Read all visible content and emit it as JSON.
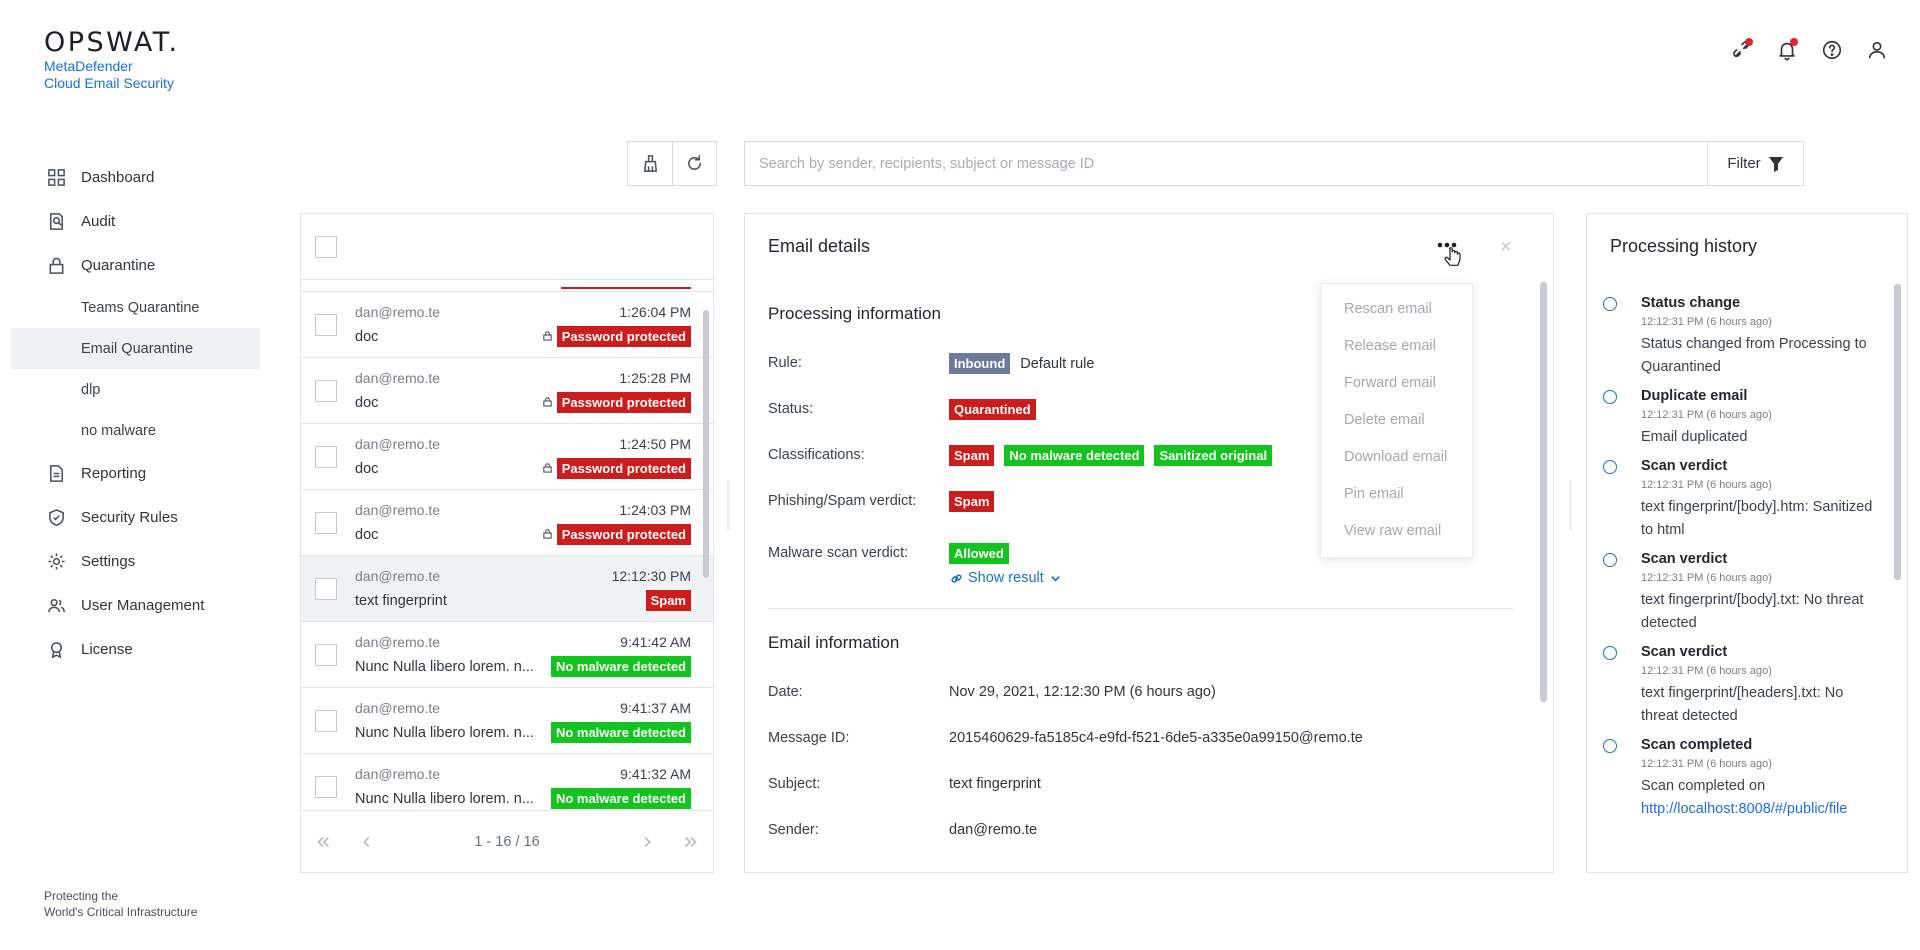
{
  "brand": {
    "wordmark": "OPSWAT.",
    "product_line1": "MetaDefender",
    "product_line2": "Cloud Email Security"
  },
  "header": {
    "icons": [
      "integration-icon",
      "bell-icon",
      "help-icon",
      "user-icon"
    ],
    "notification_color": "#e0262e"
  },
  "nav": {
    "items": [
      {
        "label": "Dashboard",
        "icon": "dashboard-icon"
      },
      {
        "label": "Audit",
        "icon": "audit-icon"
      },
      {
        "label": "Quarantine",
        "icon": "lock-icon"
      },
      {
        "label": "Reporting",
        "icon": "report-icon"
      },
      {
        "label": "Security Rules",
        "icon": "shield-check-icon"
      },
      {
        "label": "Settings",
        "icon": "gear-icon"
      },
      {
        "label": "User Management",
        "icon": "users-icon"
      },
      {
        "label": "License",
        "icon": "license-icon"
      }
    ],
    "quarantine_sub": [
      "Teams Quarantine",
      "Email Quarantine",
      "dlp",
      "no malware"
    ],
    "active_sub": "Email Quarantine"
  },
  "footer": {
    "line1": "Protecting the",
    "line2": "World's Critical Infrastructure"
  },
  "toolbar": {
    "search_placeholder": "Search by sender, recipients, subject or message ID",
    "search_value": "",
    "filter_label": "Filter"
  },
  "email_list": {
    "rows": [
      {
        "sender": "dan@remo.te",
        "time": "1:26:04 PM",
        "subject": "doc",
        "badge": "Password protected",
        "badge_color": "red",
        "locked": true,
        "selected": false
      },
      {
        "sender": "dan@remo.te",
        "time": "1:25:28 PM",
        "subject": "doc",
        "badge": "Password protected",
        "badge_color": "red",
        "locked": true,
        "selected": false
      },
      {
        "sender": "dan@remo.te",
        "time": "1:24:50 PM",
        "subject": "doc",
        "badge": "Password protected",
        "badge_color": "red",
        "locked": true,
        "selected": false
      },
      {
        "sender": "dan@remo.te",
        "time": "1:24:03 PM",
        "subject": "doc",
        "badge": "Password protected",
        "badge_color": "red",
        "locked": true,
        "selected": false
      },
      {
        "sender": "dan@remo.te",
        "time": "12:12:30 PM",
        "subject": "text fingerprint",
        "badge": "Spam",
        "badge_color": "red",
        "locked": false,
        "selected": true
      },
      {
        "sender": "dan@remo.te",
        "time": "9:41:42 AM",
        "subject": "Nunc Nulla libero lorem. n...",
        "badge": "No malware detected",
        "badge_color": "green",
        "locked": false,
        "selected": false
      },
      {
        "sender": "dan@remo.te",
        "time": "9:41:37 AM",
        "subject": "Nunc Nulla libero lorem. n...",
        "badge": "No malware detected",
        "badge_color": "green",
        "locked": false,
        "selected": false
      },
      {
        "sender": "dan@remo.te",
        "time": "9:41:32 AM",
        "subject": "Nunc Nulla libero lorem. n...",
        "badge": "No malware detected",
        "badge_color": "green",
        "locked": false,
        "selected": false
      }
    ],
    "pagination": "1 - 16 / 16"
  },
  "details": {
    "title": "Email details",
    "close": "×",
    "processing": {
      "heading": "Processing information",
      "rule_label": "Rule:",
      "rule_badge": "Inbound",
      "rule_value": "Default rule",
      "status_label": "Status:",
      "status_badge": "Quarantined",
      "classifications_label": "Classifications:",
      "classifications": [
        {
          "text": "Spam",
          "color": "red"
        },
        {
          "text": "No malware detected",
          "color": "green"
        },
        {
          "text": "Sanitized original",
          "color": "green"
        }
      ],
      "phishing_label": "Phishing/Spam verdict:",
      "phishing_badge": "Spam",
      "malware_label": "Malware scan verdict:",
      "malware_badge": "Allowed",
      "show_result": "Show result"
    },
    "info": {
      "heading": "Email information",
      "date_label": "Date:",
      "date_value": "Nov 29, 2021, 12:12:30 PM (6 hours ago)",
      "msgid_label": "Message ID:",
      "msgid_value": "2015460629-fa5185c4-e9fd-f521-6de5-a335e0a99150@remo.te",
      "subject_label": "Subject:",
      "subject_value": "text fingerprint",
      "sender_label": "Sender:",
      "sender_value": "dan@remo.te"
    }
  },
  "action_menu": {
    "items": [
      "Rescan email",
      "Release email",
      "Forward email",
      "Delete email",
      "Download email",
      "Pin email",
      "View raw email"
    ]
  },
  "history": {
    "title": "Processing history",
    "items": [
      {
        "title": "Status change",
        "time": "12:12:31 PM (6 hours ago)",
        "desc": "Status changed from Processing to Quarantined"
      },
      {
        "title": "Duplicate email",
        "time": "12:12:31 PM (6 hours ago)",
        "desc": "Email duplicated"
      },
      {
        "title": "Scan verdict",
        "time": "12:12:31 PM (6 hours ago)",
        "desc": "text fingerprint/[body].htm: Sanitized to html"
      },
      {
        "title": "Scan verdict",
        "time": "12:12:31 PM (6 hours ago)",
        "desc": "text fingerprint/[body].txt: No threat detected"
      },
      {
        "title": "Scan verdict",
        "time": "12:12:31 PM (6 hours ago)",
        "desc": "text fingerprint/[headers].txt: No threat detected"
      },
      {
        "title": "Scan completed",
        "time": "12:12:31 PM (6 hours ago)",
        "desc": "Scan completed on",
        "link": "http://localhost:8008/#/public/file"
      }
    ]
  }
}
